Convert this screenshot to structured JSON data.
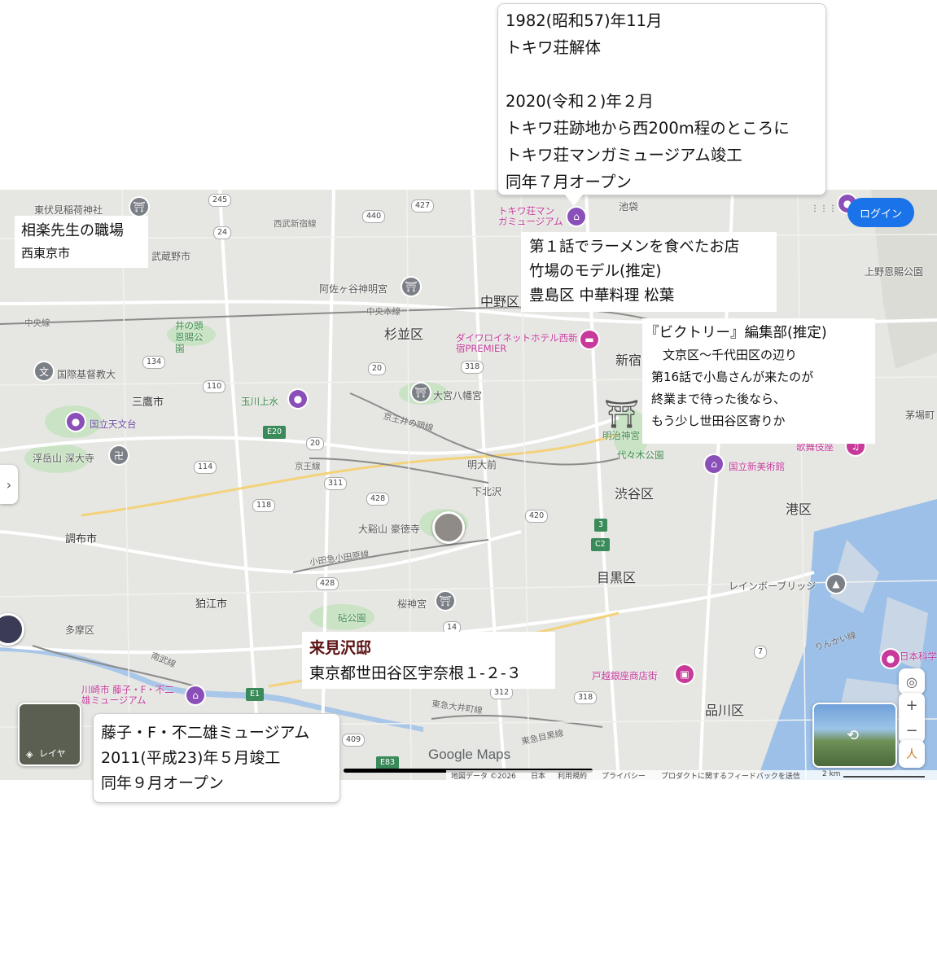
{
  "map": {
    "wards": [
      "杉並区",
      "中野区",
      "新宿",
      "渋谷区",
      "目黒区",
      "品川区",
      "港区",
      "豊島区",
      "三鷹市",
      "調布市",
      "狛江市",
      "多摩区",
      "武蔵野市"
    ],
    "places": [
      "東伏見稲荷神社",
      "西武新宿線",
      "阿佐ヶ谷神明宮",
      "中央本線",
      "中央線",
      "井の頭恩賜公園",
      "国際基督教大",
      "国立天文台",
      "浮岳山 深大寺",
      "玉川上水",
      "大宮八幡宮",
      "京王井の頭線",
      "明大前",
      "京王線",
      "下北沢",
      "大谿山 豪徳寺",
      "小田急小田原線",
      "砧公園",
      "桜神宮",
      "南武線",
      "明治神宮",
      "代々木公園",
      "国立新美術館",
      "歌舞伎座",
      "レインボーブリッジ",
      "戸越銀座商店街",
      "りんかい線",
      "東急大井町線",
      "東急目黒線",
      "上野恩賜公園",
      "日本科学",
      "茅場町",
      "池袋",
      "トキワ荘マンガミュージアム",
      "ダイワロイネットホテル西新宿PREMIER",
      "川崎市 藤子・F・不二雄ミュージアム"
    ],
    "road_numbers": [
      "245",
      "440",
      "427",
      "24",
      "134",
      "110",
      "E20",
      "20",
      "114",
      "311",
      "428",
      "118",
      "318",
      "20",
      "420",
      "3",
      "C2",
      "428",
      "E1",
      "409",
      "E83",
      "312",
      "318",
      "14",
      "7"
    ],
    "google_logo": "Google Maps",
    "login_label": "ログイン",
    "layers_label": "レイヤ",
    "footer_items": [
      "地図データ ©2026",
      "日本",
      "利用規約",
      "プライバシー",
      "プロダクトに関するフィードバックを送信",
      "2 km"
    ],
    "controls": {
      "locate": "◎",
      "zoom_in": "+",
      "zoom_out": "−",
      "pegman": "人",
      "expand": "›",
      "apps": "⋮⋮⋮"
    }
  },
  "callouts": {
    "tokiwa": {
      "lines": [
        "1982(昭和57)年11月",
        "トキワ荘解体",
        "",
        "2020(令和２)年２月",
        "トキワ荘跡地から西200m程のところに",
        "トキワ荘マンガミュージアム竣工",
        "同年７月オープン"
      ]
    },
    "ramen": {
      "lines": [
        "第１話でラーメンを食べたお店",
        "竹場のモデル(推定)",
        "豊島区 中華料理 松葉"
      ]
    },
    "victory": {
      "lines": [
        "『ビクトリー』編集部(推定)",
        "文京区〜千代田区の辺り",
        "第16話で小島さんが来たのが",
        "終業まで待った後なら、",
        "もう少し世田谷区寄りか"
      ]
    },
    "aira": {
      "title": "相楽先生の職場",
      "sub": "西東京市"
    },
    "kimisawa": {
      "title": "来見沢邸",
      "sub": "東京都世田谷区宇奈根１-２-３"
    },
    "fujiko": {
      "lines": [
        "藤子・F・不二雄ミュージアム",
        "2011(平成23)年５月竣工",
        "同年９月オープン"
      ]
    }
  }
}
